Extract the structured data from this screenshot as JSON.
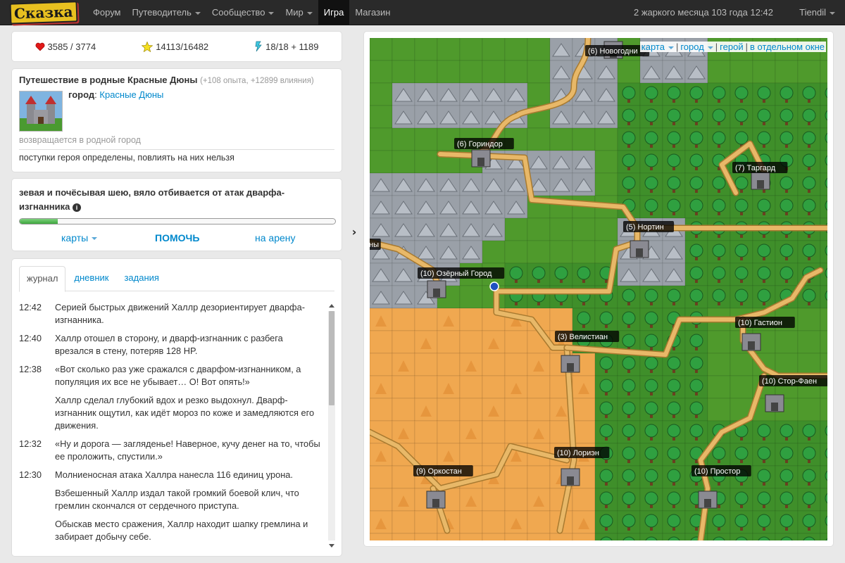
{
  "app": {
    "logo": "Сказка"
  },
  "nav": {
    "items": [
      {
        "label": "Форум"
      },
      {
        "label": "Путеводитель"
      },
      {
        "label": "Сообщество"
      },
      {
        "label": "Мир"
      },
      {
        "label": "Игра"
      },
      {
        "label": "Магазин"
      }
    ]
  },
  "header": {
    "datetime": "2 жаркого месяца 103 года 12:42",
    "user": "Tiendil"
  },
  "stats": {
    "health": "3585 / 3774",
    "experience": "14113/16482",
    "energy": "18/18 + 1189"
  },
  "quest": {
    "title": "Путешествие в родные Красные Дюны",
    "bonus": "(+108 опыта, +12899 влияния)",
    "city_label": "город",
    "city_name": "Красные Дюны",
    "status": "возвращается в родной город",
    "note": "поступки героя определены, повлиять на них нельзя"
  },
  "action": {
    "text": "зевая и почёсывая шею, вяло отбивается от атак дварфа-изгнанника",
    "progress": 12,
    "cards": "карты",
    "help": "ПОМОЧЬ",
    "arena": "на арену"
  },
  "journal": {
    "tabs": [
      "журнал",
      "дневник",
      "задания"
    ],
    "entries": [
      {
        "time": "12:42",
        "text": "Серией быстрых движений Халлр дезориентирует дварфа-изгнанника."
      },
      {
        "time": "12:40",
        "text": "Халлр отошел в сторону, и дварф-изгнанник с разбега врезался в стену, потеряв 128 HP."
      },
      {
        "time": "12:38",
        "text": "«Вот сколько раз уже сражался с дварфом-изгнанником, а популяция их все не убывает… О! Вот опять!»"
      },
      {
        "time": "",
        "text": "Халлр сделал глубокий вдох и резко выдохнул. Дварф-изгнанник ощутил, как идёт мороз по коже и замедляются его движения."
      },
      {
        "time": "12:32",
        "text": "«Ну и дорога — загляденье! Наверное, кучу денег на то, чтобы ее проложить, спустили.»"
      },
      {
        "time": "12:30",
        "text": "Молниеносная атака Халлра нанесла 116 единиц урона."
      },
      {
        "time": "",
        "text": "Взбешенный Халлр издал такой громкий боевой клич, что гремлин скончался от сердечного приступа."
      },
      {
        "time": "",
        "text": "Обыскав место сражения, Халлр находит шапку гремлина и забирает добычу себе."
      }
    ]
  },
  "map": {
    "links": {
      "map": "карта",
      "city": "город",
      "hero": "герой",
      "window": "в отдельном окне"
    },
    "cities": [
      {
        "label": "(6) Новогодни"
      },
      {
        "label": "(6) Гориндор"
      },
      {
        "label": "(7) Таргард"
      },
      {
        "label": "(5) Нортин"
      },
      {
        "label": "ны"
      },
      {
        "label": "(10) Озёрный Город"
      },
      {
        "label": "(3) Велистиан"
      },
      {
        "label": "(10) Гастион"
      },
      {
        "label": "(10) Стор-Фаен"
      },
      {
        "label": "(10) Лориэн"
      },
      {
        "label": "(9) Оркостан"
      },
      {
        "label": "(10) Простор"
      }
    ]
  },
  "colors": {
    "grass": "#4f9a2c",
    "mountain": "#9aa0a8",
    "desert": "#f0a850",
    "forest": "#3f8f2a",
    "road": "#e8b868",
    "accent": "#0088cc",
    "navbar": "#2a2a2a"
  }
}
